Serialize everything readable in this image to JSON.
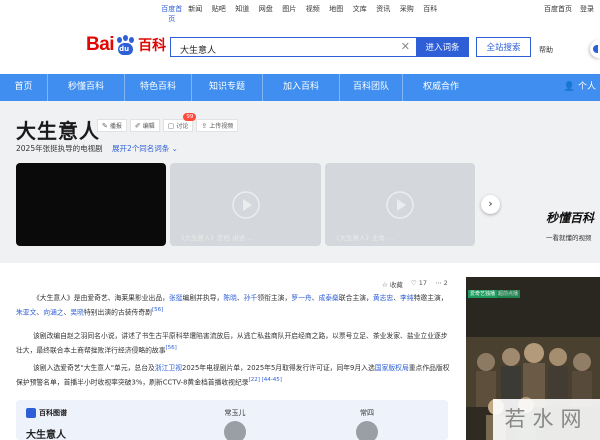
{
  "topnav": {
    "links": [
      "百度首页",
      "新闻",
      "贴吧",
      "知道",
      "网盘",
      "图片",
      "视频",
      "地图",
      "文库",
      "资讯",
      "采购",
      "百科"
    ],
    "right": [
      "百度首页",
      "登录"
    ]
  },
  "logo": {
    "text1": "Bai",
    "paw": "du",
    "text2": "百科"
  },
  "search": {
    "value": "大生意人",
    "enter_label": "进入词条",
    "site_label": "全站搜索",
    "help": "帮助"
  },
  "bluebar": {
    "items": [
      "首页",
      "秒懂百科",
      "特色百科",
      "知识专题",
      "加入百科",
      "百科团队",
      "权威合作"
    ],
    "me": "个人"
  },
  "hero": {
    "title": "大生意人",
    "actions": [
      {
        "icon": "✎",
        "label": "播报"
      },
      {
        "icon": "✐",
        "label": "编辑"
      },
      {
        "icon": "▢",
        "label": "讨论",
        "badge": "99"
      },
      {
        "icon": "⇪",
        "label": "上传视频"
      }
    ],
    "subtitle": "2025年张挺执导的电视剧",
    "expand": "展开2个同名词条",
    "card_captions": [
      "《大生意人》定档 讲述 …",
      "《大生意人》主角 …"
    ],
    "promo1": "秒懂百科",
    "promo2": "一看就懂的视频"
  },
  "content": {
    "toolbar": [
      "☆ 收藏",
      "♡ 17",
      "⋯ 2"
    ],
    "para1": {
      "a": "《大生意人》是由爱奇艺、海莱果影业出品，",
      "b": "张挺",
      "c": "编剧并执导，",
      "d": "陈晓",
      "e": "、",
      "f": "孙千",
      "g": "领衔主演，",
      "h": "罗一舟",
      "i": "、",
      "j": "成泰燊",
      "k": "联合主演，",
      "l": "黄志忠",
      "m": "、",
      "n": "李纯",
      "o": "特邀主演，",
      "p": "朱亚文",
      "q": "、",
      "r": "向涵之",
      "s": "、",
      "t": "吴晓",
      "u": "特别出演的古装传奇剧",
      "ref": "[56]"
    },
    "para2": {
      "a": "该剧改编自赵之羽同名小说，讲述了书生古平原科举遭陷害流放后，从逃亡私盐商队开启经商之路，以票号立足、茶业发家、盐业立业逐步壮大，最终联合本土商帮挫败洋行经济侵略的故事",
      "ref": "[56]"
    },
    "para3": {
      "a": "该剧入选爱奇艺\"大生意人\"单元，总台及",
      "b": "浙江卫视",
      "c": "2025年电视剧片单，2025年5月取得发行许可证，同年9月入选",
      "d": "国家版权局",
      "e": "重点作品版权保护预警名单，首播半小时收视率突破3%，刷新CCTV-8黄金档首播收视纪录",
      "ref": "[22] [44-45]"
    },
    "tupu": {
      "header": "百科图谱",
      "name": "大生意人",
      "people": [
        "常玉儿",
        "常四"
      ]
    },
    "poster_tags": [
      "爱奇艺独播",
      "超前点播"
    ],
    "watermark": "若水网"
  },
  "colors": {
    "accent": "#2e5fd6",
    "navbar": "#3f8ef0",
    "brand_red": "#e10601"
  }
}
